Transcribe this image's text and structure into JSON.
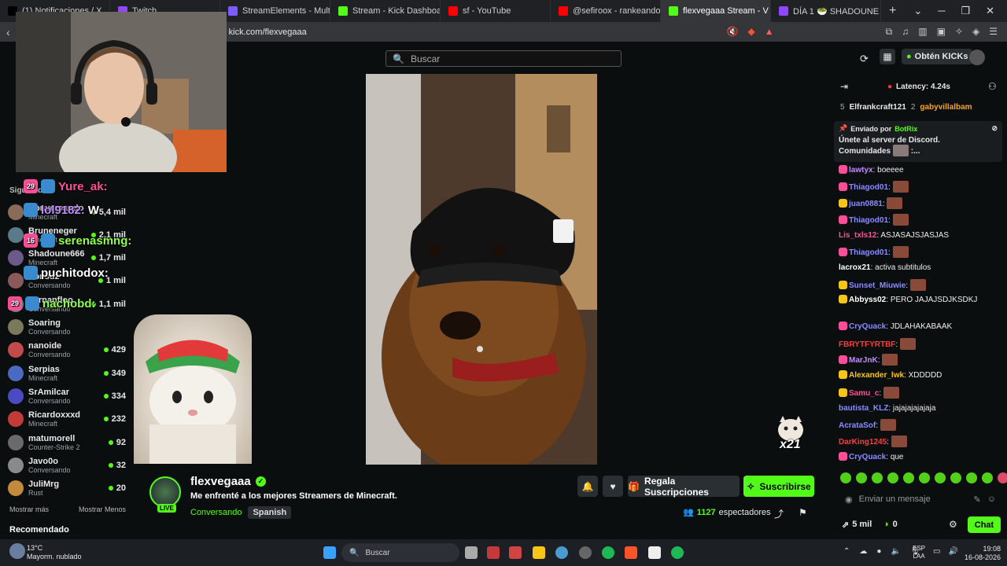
{
  "browser": {
    "tabs": [
      {
        "label": "(1) Notificaciones / X",
        "color": "#000000"
      },
      {
        "label": "Twitch",
        "color": "#9146ff"
      },
      {
        "label": "StreamElements - Multi-Strea",
        "color": "#7c5cff"
      },
      {
        "label": "Stream - Kick Dashboard",
        "color": "#53fc18"
      },
      {
        "label": "sf - YouTube",
        "color": "#ff0000"
      },
      {
        "label": "@sefiroox - rankeando (Wis",
        "color": "#ff0000"
      },
      {
        "label": "flexvegaaa Stream - V",
        "color": "#53fc18"
      },
      {
        "label": "DÍA 1 🥗 SHADOUNE GA",
        "color": "#9146ff"
      }
    ],
    "url": "kick.com/flexvegaaa"
  },
  "header": {
    "search_placeholder": "Buscar",
    "kicks_button": "Obtén KICKs"
  },
  "sidebar": {
    "section_title": "Siguiendo",
    "channels": [
      {
        "name": "Conversando",
        "game": "Minecraft",
        "viewers": "5,4 mil",
        "color": "#8a6b5a"
      },
      {
        "name": "Bruneneger",
        "game": "Minecraft",
        "viewers": "2,1 mil",
        "color": "#5a7a8a"
      },
      {
        "name": "Shadoune666",
        "game": "Minecraft",
        "viewers": "1,7 mil",
        "color": "#6b5a8a"
      },
      {
        "name": "Ponsuz",
        "game": "Conversando",
        "viewers": "1 mil",
        "color": "#8a5a5a"
      },
      {
        "name": "Fernanfloo",
        "game": "Conversando",
        "viewers": "1,1 mil",
        "color": "#5a8a6b"
      },
      {
        "name": "Soaring",
        "game": "Conversando",
        "viewers": "",
        "color": "#7a7a5a"
      },
      {
        "name": "nanoide",
        "game": "Conversando",
        "viewers": "429",
        "color": "#c24a4a"
      },
      {
        "name": "Serpias",
        "game": "Minecraft",
        "viewers": "349",
        "color": "#4a6ac2"
      },
      {
        "name": "SrAmilcar",
        "game": "Conversando",
        "viewers": "334",
        "color": "#4a4ac2"
      },
      {
        "name": "Ricardoxxxd",
        "game": "Minecraft",
        "viewers": "232",
        "color": "#c23a3a"
      },
      {
        "name": "matumorell",
        "game": "Counter-Strike 2",
        "viewers": "92",
        "color": "#6a6a6a"
      },
      {
        "name": "Javo0o",
        "game": "Conversando",
        "viewers": "32",
        "color": "#8a8a8a"
      },
      {
        "name": "JuliMrg",
        "game": "Rust",
        "viewers": "20",
        "color": "#c28a3a"
      }
    ],
    "show_more": "Mostrar más",
    "show_less": "Mostrar Menos",
    "recommended": "Recomendado"
  },
  "overlay_chat": [
    {
      "user": "Yure_ak:",
      "text": "",
      "color": "#ff4f9a",
      "badge": "29"
    },
    {
      "user": "lol9182:",
      "text": "W",
      "color": "#c08cff",
      "badge": ""
    },
    {
      "user": "serenasmng:",
      "text": "",
      "color": "#8cff4c",
      "badge": "16"
    },
    {
      "user": "puchitodox:",
      "text": "",
      "color": "#ffffff",
      "badge": ""
    },
    {
      "user": "nachobd:",
      "text": "",
      "color": "#8cff4c",
      "badge": "29"
    }
  ],
  "overlay_x21": "x21",
  "stream": {
    "streamer": "flexvegaaa",
    "live_label": "LIVE",
    "title": "Me enfrenté a los mejores Streamers de Minecraft.",
    "category": "Conversando",
    "language": "Spanish",
    "viewers_count": "1127",
    "viewers_label": "espectadores",
    "gift_button": "Regala Suscripciones",
    "subscribe_button": "Suscribirse"
  },
  "chat": {
    "latency": "Latency: 4.24s",
    "leaderboard": {
      "rank": "5",
      "user1": "Elfrankcraft121",
      "n1": "2",
      "user2": "gabyvillalbam"
    },
    "pinned": {
      "sent_by": "Enviado por",
      "bot": "BotRix",
      "line1": "Únete al server de Discord.",
      "line2": "Comunidades",
      "line2_tail": ":..."
    },
    "messages": [
      {
        "user": "lawtyx",
        "text": "boeeee",
        "color": "#c08cff",
        "badge": "#ff4f9a"
      },
      {
        "user": "Thiagod01",
        "text": "",
        "color": "#8a8cff",
        "badge": "#ff4f9a",
        "emote": true
      },
      {
        "user": "juan0881",
        "text": "",
        "color": "#8a8cff",
        "badge": "#f5c518",
        "emote": true
      },
      {
        "user": "Thiagod01",
        "text": "",
        "color": "#8a8cff",
        "badge": "#ff4f9a",
        "emote": true
      },
      {
        "user": "Lis_txls12",
        "text": "ASJASAJSJASJAS",
        "color": "#ff4f9a",
        "badge": ""
      },
      {
        "user": "Thiagod01",
        "text": "",
        "color": "#8a8cff",
        "badge": "#ff4f9a",
        "emote": true
      },
      {
        "user": "lacrox21",
        "text": "activa subtitulos",
        "color": "#ffffff",
        "badge": ""
      },
      {
        "user": "Sunset_Miuwie",
        "text": "",
        "color": "#8a8cff",
        "badge": "#f5c518",
        "emote": true
      },
      {
        "user": "Abbyss02",
        "text": "PERO JAJAJSDJKSDKJ",
        "color": "#ffffff",
        "badge": "#f5c518"
      },
      {
        "user": "CryQuack",
        "text": "JDLAHAKABAAK",
        "color": "#8a8cff",
        "badge": "#ff4f9a"
      },
      {
        "user": "FBRYTFYRTBF",
        "text": "",
        "color": "#ff3b3b",
        "badge": "",
        "emote": true
      },
      {
        "user": "MarJnK",
        "text": "",
        "color": "#c08cff",
        "badge": "#ff4f9a",
        "emote": true
      },
      {
        "user": "Alexander_lwk",
        "text": "XDDDDD",
        "color": "#f5c518",
        "badge": "#f5c518"
      },
      {
        "user": "Samu_c",
        "text": "",
        "color": "#ff4f9a",
        "badge": "#f5c518",
        "emote": true
      },
      {
        "user": "bautista_KLZ",
        "text": "jajajajajajaja",
        "color": "#8a8cff",
        "badge": ""
      },
      {
        "user": "AcrataSof",
        "text": "",
        "color": "#8a8cff",
        "badge": "",
        "emote": true
      },
      {
        "user": "DarKing1245",
        "text": "",
        "color": "#ff3b3b",
        "badge": "",
        "emote": true
      },
      {
        "user": "CryQuack",
        "text": "que",
        "color": "#8a8cff",
        "badge": "#ff4f9a"
      }
    ],
    "input_placeholder": "Enviar un mensaje",
    "kicks_count": "5 mil",
    "points": "0",
    "chat_button": "Chat"
  },
  "taskbar": {
    "weather_temp": "13°C",
    "weather_desc": "Mayorm. nublado",
    "search_label": "Buscar",
    "lang": "ESP",
    "lang2": "LAA",
    "time": "19:08",
    "date": "16-08-2026"
  }
}
